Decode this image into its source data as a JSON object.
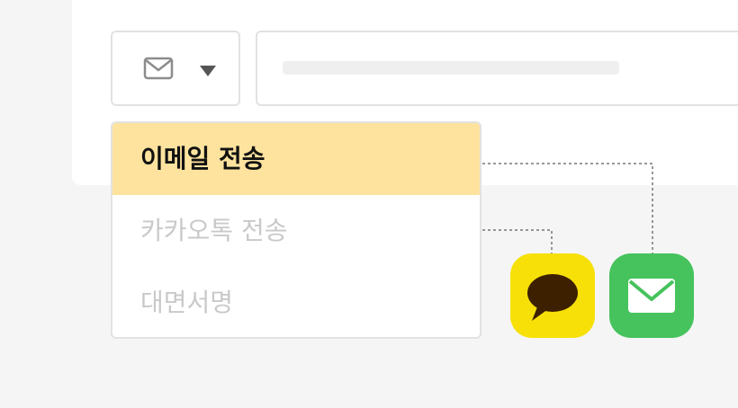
{
  "dropdown": {
    "selected_icon": "mail-icon",
    "options": [
      {
        "label": "이메일 전송",
        "state": "selected"
      },
      {
        "label": "카카오톡 전송",
        "state": "disabled"
      },
      {
        "label": "대면서명",
        "state": "disabled"
      }
    ]
  },
  "channels": [
    {
      "name": "kakaotalk",
      "icon": "kakaotalk-bubble-icon",
      "color": "#f7e007"
    },
    {
      "name": "email",
      "icon": "envelope-icon",
      "color": "#46c35c"
    }
  ],
  "colors": {
    "selected_option_bg": "#fee39f",
    "disabled_text": "#c9c9c9",
    "kakao_brown": "#3d2000"
  }
}
